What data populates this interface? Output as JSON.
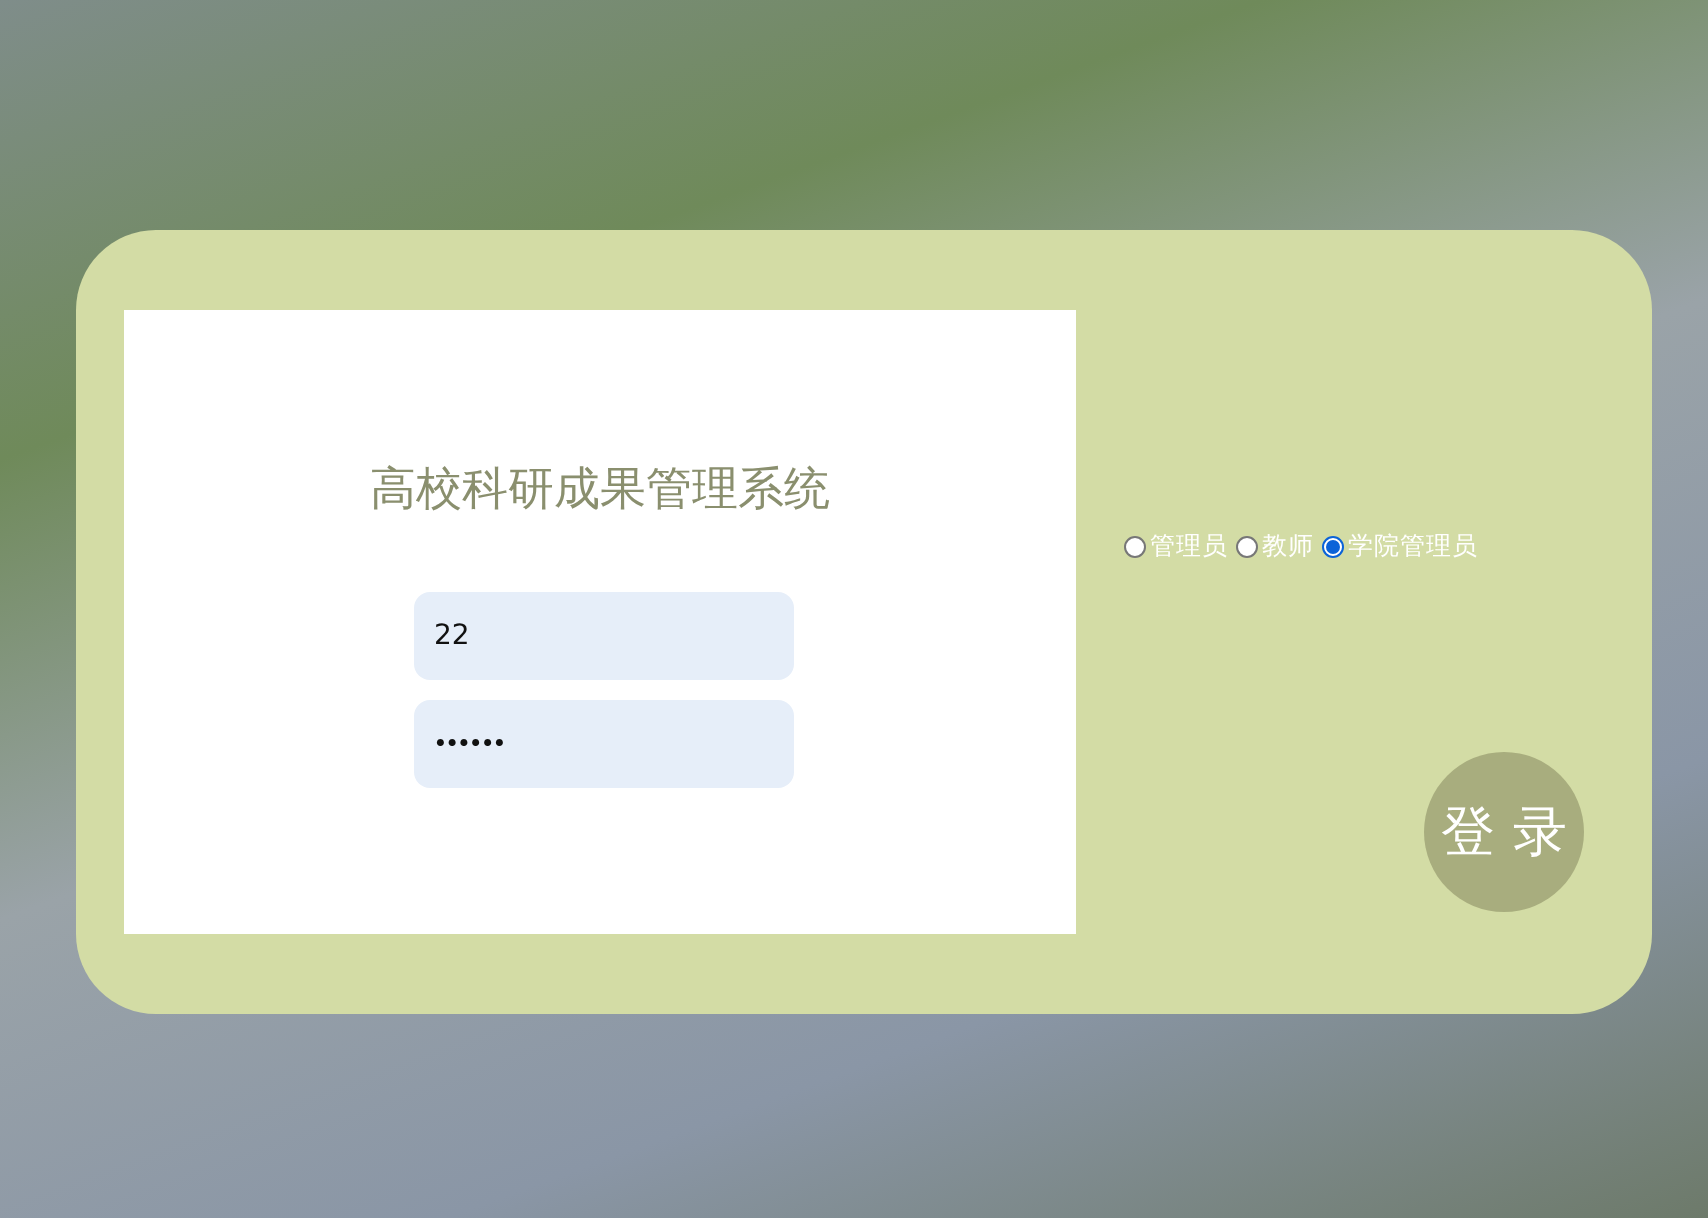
{
  "title": "高校科研成果管理系统",
  "fields": [
    {
      "kind": "text",
      "value": "22"
    },
    {
      "kind": "password",
      "value": "••••••"
    }
  ],
  "roles": [
    {
      "label": "管理员",
      "selected": false
    },
    {
      "label": "教师",
      "selected": false
    },
    {
      "label": "学院管理员",
      "selected": true
    }
  ],
  "login_button": "登 录"
}
